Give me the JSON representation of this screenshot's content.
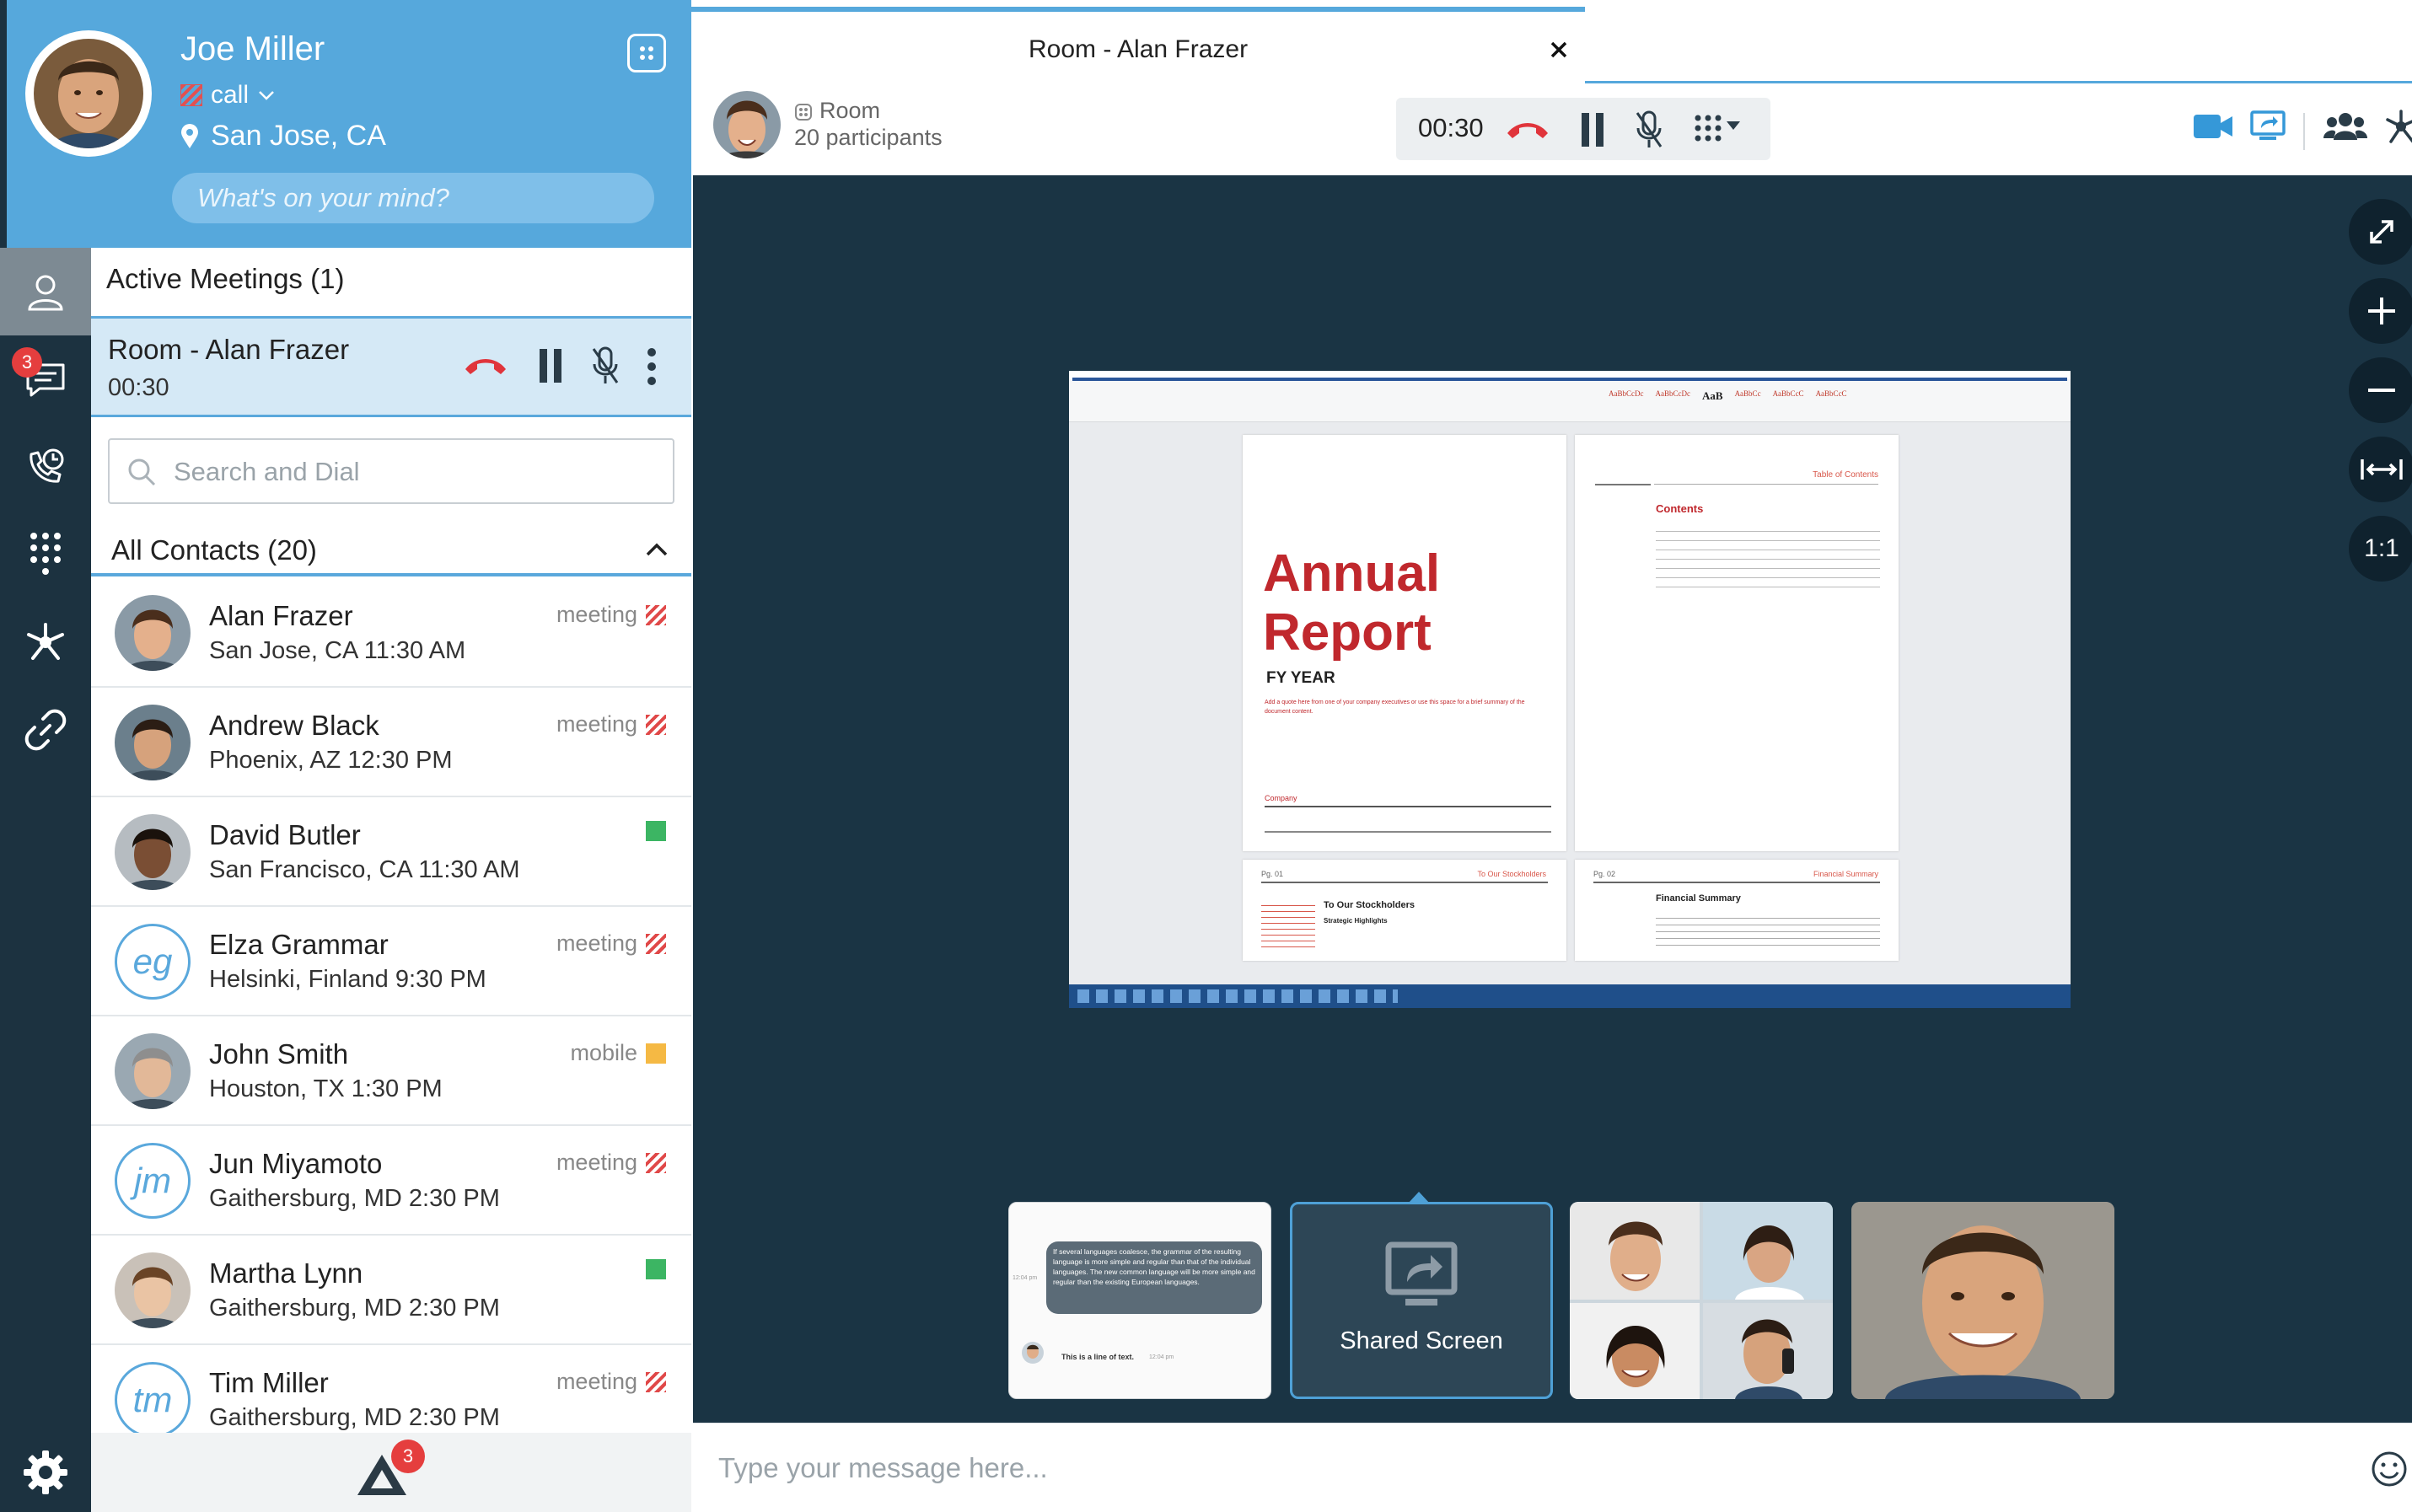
{
  "profile": {
    "name": "Joe Miller",
    "status": "call",
    "location": "San Jose, CA",
    "mood_placeholder": "What's on your mind?"
  },
  "rail": {
    "chat_badge": "3",
    "bottom_badge": "3"
  },
  "sidebar": {
    "active_meetings_title": "Active Meetings (1)",
    "active_meeting": {
      "name": "Room - Alan Frazer",
      "timer": "00:30"
    },
    "search_placeholder": "Search and Dial",
    "contacts_title": "All Contacts (20)",
    "contacts": [
      {
        "name": "Alan Frazer",
        "location": "San Jose, CA 11:30 AM",
        "status": "meeting",
        "indicator": "meeting",
        "avatar": "photo"
      },
      {
        "name": "Andrew Black",
        "location": "Phoenix, AZ 12:30 PM",
        "status": "meeting",
        "indicator": "meeting",
        "avatar": "photo"
      },
      {
        "name": "David Butler",
        "location": "San Francisco, CA 11:30 AM",
        "status": "",
        "indicator": "available",
        "avatar": "photo"
      },
      {
        "name": "Elza Grammar",
        "location": "Helsinki, Finland 9:30 PM",
        "status": "meeting",
        "indicator": "meeting",
        "avatar": "eg"
      },
      {
        "name": "John Smith",
        "location": "Houston, TX 1:30 PM",
        "status": "mobile",
        "indicator": "mobile",
        "avatar": "photo"
      },
      {
        "name": "Jun Miyamoto",
        "location": "Gaithersburg, MD 2:30 PM",
        "status": "meeting",
        "indicator": "meeting",
        "avatar": "jm"
      },
      {
        "name": "Martha Lynn",
        "location": "Gaithersburg, MD 2:30 PM",
        "status": "",
        "indicator": "available",
        "avatar": "photo"
      },
      {
        "name": "Tim Miller",
        "location": "Gaithersburg, MD 2:30 PM",
        "status": "meeting",
        "indicator": "meeting",
        "avatar": "tm"
      }
    ]
  },
  "main": {
    "tab_title": "Room - Alan Frazer",
    "room_label": "Room",
    "participants": "20 participants",
    "call_timer": "00:30",
    "zoom_controls": [
      "1:1"
    ],
    "document": {
      "title_line1": "Annual",
      "title_line2": "Report",
      "subtitle": "FY YEAR",
      "quote": "Add a quote here from one of your company executives or use this space for a brief summary of the document content.",
      "company": "Company",
      "toc_header": "Table of Contents",
      "contents": "Contents",
      "page1": "Pg. 01",
      "page1_header": "To Our Stockholders",
      "page1_title": "To Our Stockholders",
      "page1_sub": "Strategic Highlights",
      "page2": "Pg. 02",
      "page2_header": "Financial Summary",
      "page2_title": "Financial Summary",
      "styles": [
        "AaBbCcDc",
        "AaBbCcDc",
        "AaBbCc",
        "AaBbCcC",
        "AaB",
        "AaBbCcC"
      ]
    },
    "chat_thumb": {
      "bubble": "If several languages coalesce, the grammar of the resulting language is more simple and regular than that of the individual languages. The new common language will be more simple and regular than the existing European languages.",
      "time1": "12:04 pm",
      "reply": "This is a line of text.",
      "time2": "12:04 pm"
    },
    "shared_screen_label": "Shared Screen",
    "message_placeholder": "Type your message here..."
  },
  "colors": {
    "accent": "#56a8dc",
    "rail": "#1c3240",
    "stage": "#1a3444",
    "hangup": "#e0343b"
  }
}
